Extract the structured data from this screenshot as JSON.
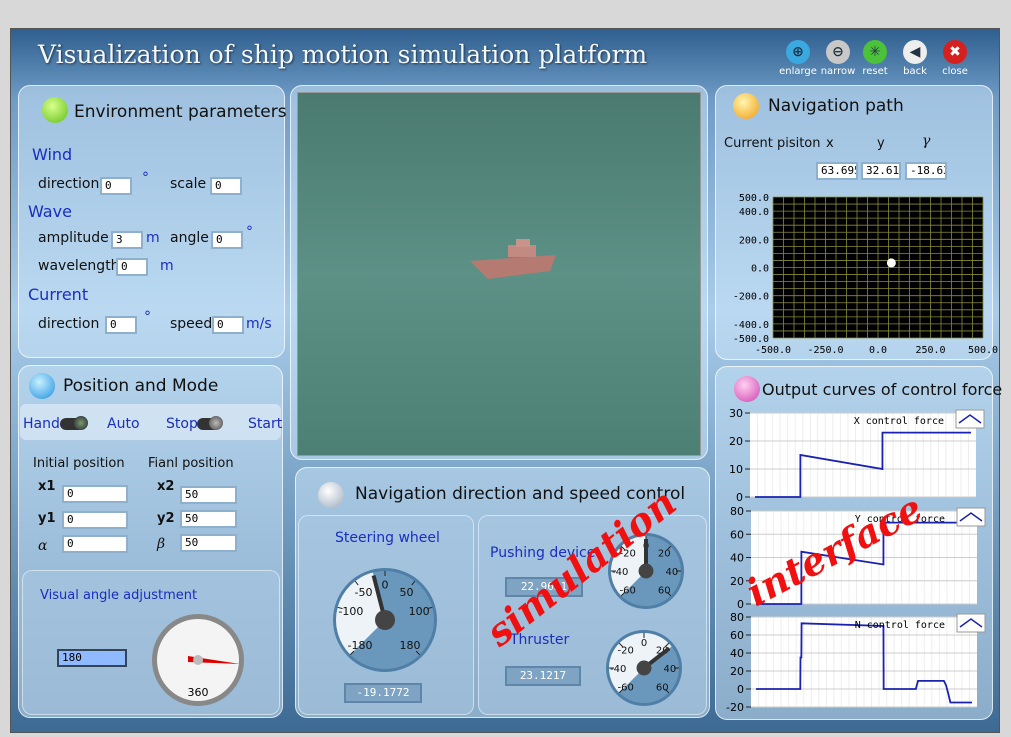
{
  "app": {
    "title": "Visualization of ship motion simulation platform"
  },
  "toolbar": [
    {
      "label": "enlarge",
      "icon": "zoom-in-icon",
      "color": "#39a9e0"
    },
    {
      "label": "narrow",
      "icon": "zoom-out-icon",
      "color": "#c8c8c8"
    },
    {
      "label": "reset",
      "icon": "reset-icon",
      "color": "#4cc13a"
    },
    {
      "label": "back",
      "icon": "back-arrow-icon",
      "color": "#eeeeee"
    },
    {
      "label": "close",
      "icon": "close-icon",
      "color": "#d62020"
    }
  ],
  "env": {
    "title": "Environment parameters",
    "wind": "Wind",
    "wave": "Wave",
    "current": "Current",
    "wind_direction_label": "direction",
    "wind_direction": "0",
    "deg": "°",
    "wind_scale_label": "scale",
    "wind_scale": "0",
    "amplitude_label": "amplitude",
    "amplitude": "3",
    "m": "m",
    "angle_label": "angle",
    "angle": "0",
    "wavelength_label": "wavelength",
    "wavelength": "0",
    "cur_direction_label": "direction",
    "cur_direction": "0",
    "speed_label": "speed",
    "speed": "0",
    "ms": "m/s"
  },
  "mode": {
    "title": "Position and Mode",
    "hand": "Hand",
    "auto": "Auto",
    "stop": "Stop",
    "start": "Start",
    "initial": "Initial position",
    "final": "Fianl position",
    "x1": "x1",
    "y1": "y1",
    "alpha": "α",
    "x1v": "0",
    "y1v": "0",
    "alphav": "0",
    "x2": "x2",
    "y2": "y2",
    "beta": "β",
    "x2v": "50",
    "y2v": "50",
    "betav": "50",
    "visual": "Visual angle adjustment",
    "visual_value": "180",
    "dial_label": "360"
  },
  "control": {
    "title": "Navigation direction and speed control",
    "steering": "Steering wheel",
    "steering_value": "-19.1772",
    "steering_ticks": [
      "-180",
      "-100",
      "-50",
      "0",
      "50",
      "100",
      "180"
    ],
    "pushing": "Pushing device",
    "pushing_value": "22.9631",
    "thruster": "Thruster",
    "thruster_value": "23.1217",
    "small_ticks": [
      "-60",
      "-40",
      "-20",
      "0",
      "20",
      "40",
      "60"
    ]
  },
  "path": {
    "title": "Navigation path",
    "current": "Current pisiton",
    "x": "x",
    "y": "y",
    "gamma": "γ",
    "xv": "63.695",
    "yv": "32.610",
    "gv": "-18.63"
  },
  "curves": {
    "title": "Output curves of control force"
  },
  "watermark": {
    "a": "simulation",
    "b": "interface"
  },
  "chart_data": [
    {
      "type": "scatter",
      "name": "navigation-path",
      "xlim": [
        -500,
        500
      ],
      "ylim": [
        -500,
        500
      ],
      "xticks": [
        "-500.0",
        "-250.0",
        "0.0",
        "250.0",
        "500.0"
      ],
      "yticks": [
        "500.0",
        "400.0",
        "200.0",
        "0.0",
        "-200.0",
        "-400.0",
        "-500.0"
      ],
      "grid": true,
      "points": [
        [
          63.695,
          32.61
        ]
      ],
      "colors": {
        "bg": "#000000",
        "grid": "#8a8a3a",
        "point": "#ffffff"
      }
    },
    {
      "type": "line",
      "title": "X control force",
      "ylim": [
        0,
        30
      ],
      "yticks": [
        0,
        10,
        20,
        30
      ],
      "x": [
        0,
        21,
        21.01,
        59,
        59.01,
        100
      ],
      "y": [
        0,
        0,
        15,
        10,
        23,
        23
      ],
      "color": "#1a22b0"
    },
    {
      "type": "line",
      "title": "Y control force",
      "ylim": [
        0,
        80
      ],
      "yticks": [
        0,
        20,
        40,
        60,
        80
      ],
      "x": [
        0,
        21,
        21.01,
        59,
        59.01,
        100
      ],
      "y": [
        0,
        0,
        45,
        34,
        70,
        70
      ],
      "color": "#1a22b0"
    },
    {
      "type": "line",
      "title": "N control force",
      "ylim": [
        -20,
        80
      ],
      "yticks": [
        -20,
        0,
        20,
        40,
        60,
        80
      ],
      "x": [
        0,
        20.5,
        20.6,
        21,
        21.1,
        59,
        59.1,
        74,
        75,
        87,
        88,
        89,
        90,
        100
      ],
      "y": [
        0,
        0,
        35,
        35,
        73,
        70,
        0,
        0,
        9,
        9,
        4,
        -5,
        -15,
        -15
      ],
      "color": "#1a22b0"
    }
  ]
}
